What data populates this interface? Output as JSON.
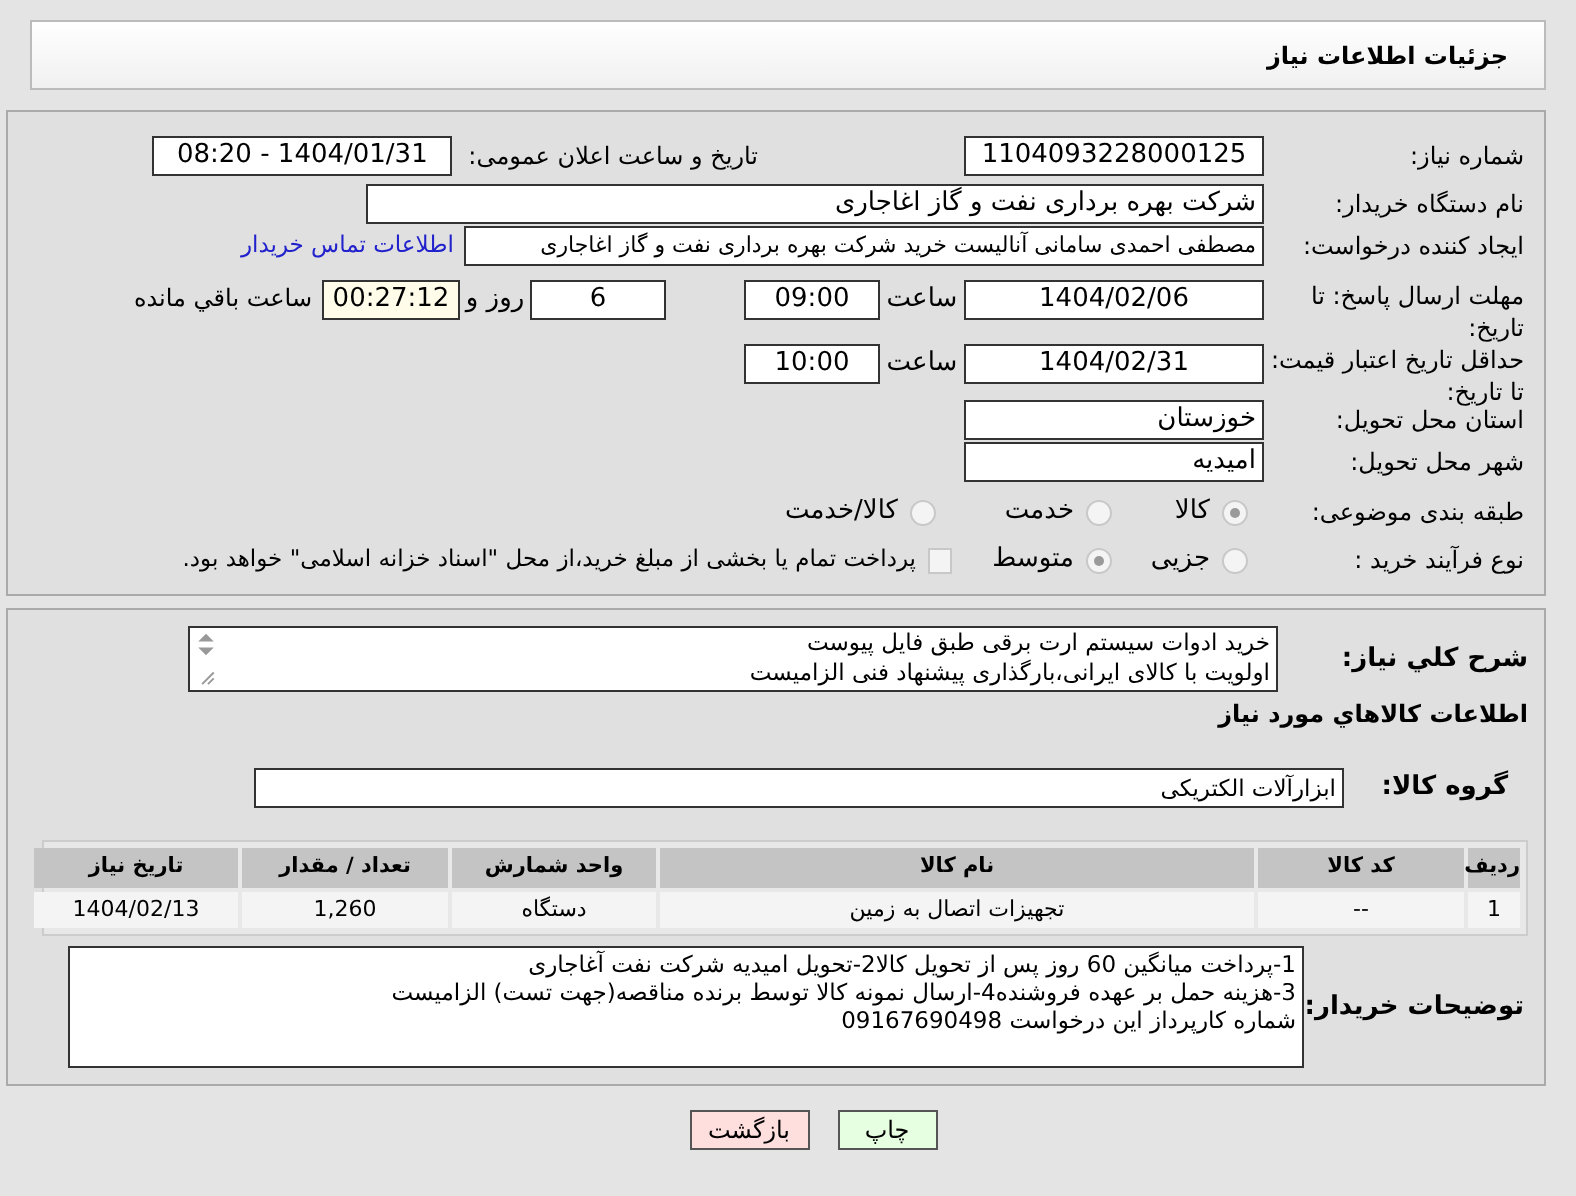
{
  "title": "جزئیات اطلاعات نیاز",
  "need_number": {
    "label": "شماره نیاز:",
    "value": "1104093228000125"
  },
  "announce": {
    "label": "تاریخ و ساعت اعلان عمومی:",
    "value": "1404/01/31 - 08:20"
  },
  "buyer": {
    "label": "نام دستگاه خریدار:",
    "value": "شرکت بهره برداری نفت و گاز اغاجاری"
  },
  "creator": {
    "label": "ایجاد کننده درخواست:",
    "value": "مصطفی احمدی سامانی آنالیست خرید شرکت بهره برداری نفت و گاز اغاجاری",
    "link": "اطلاعات تماس خریدار"
  },
  "reply_deadline": {
    "label": "مهلت ارسال پاسخ: تا تاریخ:",
    "date": "1404/02/06",
    "time_label": "ساعت",
    "time": "09:00",
    "days": "6",
    "days_label": "روز و",
    "remaining": "00:27:12",
    "remaining_label": "ساعت باقي مانده"
  },
  "price_validity": {
    "label": "حداقل تاریخ اعتبار قیمت: تا تاریخ:",
    "date": "1404/02/31",
    "time_label": "ساعت",
    "time": "10:00"
  },
  "province": {
    "label": "استان محل تحویل:",
    "value": "خوزستان"
  },
  "city": {
    "label": "شهر محل تحویل:",
    "value": "امیدیه"
  },
  "category": {
    "label": "طبقه بندی موضوعی:",
    "options": [
      {
        "label": "کالا",
        "selected": true
      },
      {
        "label": "خدمت",
        "selected": false
      },
      {
        "label": "کالا/خدمت",
        "selected": false
      }
    ]
  },
  "purchase_type": {
    "label": "نوع فرآیند خرید :",
    "options": [
      {
        "label": "جزیی",
        "selected": false
      },
      {
        "label": "متوسط",
        "selected": true
      }
    ],
    "treasury": {
      "checked": false,
      "text": "پرداخت تمام یا بخشی از مبلغ خرید،از محل \"اسناد خزانه اسلامی\" خواهد بود."
    }
  },
  "description": {
    "label": "شرح کلي نياز:",
    "lines": [
      "خرید ادوات سیستم ارت برقی طبق فایل پیوست",
      "اولویت با کالای ایرانی،بارگذاری پیشنهاد فنی الزامیست"
    ]
  },
  "goods_heading": "اطلاعات کالاهاي مورد نياز",
  "goods_group": {
    "label": "گروه کالا:",
    "value": "ابزارآلات الکتریکی"
  },
  "table": {
    "columns": [
      "ردیف",
      "کد کالا",
      "نام کالا",
      "واحد شمارش",
      "تعداد / مقدار",
      "تاریخ نیاز"
    ],
    "rows": [
      [
        "1",
        "--",
        "تجهیزات اتصال به زمین",
        "دستگاه",
        "1,260",
        "1404/02/13"
      ]
    ]
  },
  "buyer_notes": {
    "label": "توضیحات خریدار:",
    "lines": [
      "1-پرداخت میانگین 60 روز پس از تحویل کالا2-تحویل امیدیه شرکت نفت آغاجاری",
      "3-هزینه حمل بر عهده فروشنده4-ارسال نمونه کالا توسط برنده مناقصه(جهت تست) الزامیست",
      "شماره کارپرداز این درخواست 09167690498"
    ]
  },
  "buttons": [
    {
      "label": "چاپ",
      "kind": "print"
    },
    {
      "label": "بازگشت",
      "kind": "back"
    }
  ]
}
